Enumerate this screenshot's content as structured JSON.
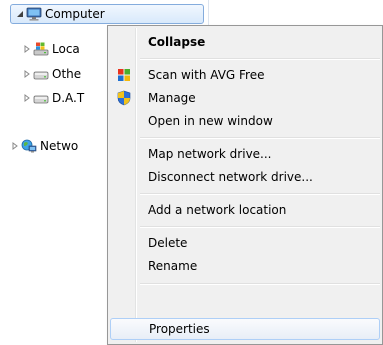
{
  "nav_tree": {
    "computer_label": "Computer",
    "local_disk_label": "Loca",
    "other_drive_label": "Othe",
    "data_drive_label": "D.A.T",
    "network_label": "Netwo"
  },
  "context_menu": {
    "collapse": "Collapse",
    "scan_avg": "Scan with AVG Free",
    "manage": "Manage",
    "open_new_window": "Open in new window",
    "map_drive": "Map network drive...",
    "disconnect_drive": "Disconnect network drive...",
    "add_network_location": "Add a network location",
    "delete": "Delete",
    "rename": "Rename",
    "properties": "Properties"
  },
  "colors": {
    "selection_border": "#84acdd",
    "menu_background": "#f0f0f0",
    "hover_border": "#aecff7"
  }
}
